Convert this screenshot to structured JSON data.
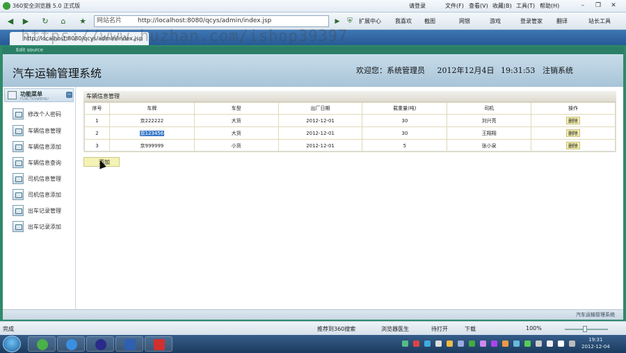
{
  "browser": {
    "title": "360安全浏览器 5.0 正式版",
    "login": "请登录",
    "menu": [
      "文件(F)",
      "查看(V)",
      "收藏(B)",
      "工具(T)",
      "帮助(H)"
    ],
    "address_label": "网站名片",
    "address_url": "http://localhost:8080/qcys/admin/index.jsp",
    "toolbar": [
      "扩展中心",
      "我喜欢",
      "截图",
      "网银",
      "游戏",
      "登录管家",
      "翻译",
      "站长工具"
    ],
    "tab_title": "http://localhost:8080/qcys/admin/index.jsp",
    "status_left": "完成",
    "status_items": [
      "推荐到360搜索",
      "浏览器医生",
      "待打开",
      "下载",
      "100%"
    ],
    "zoom": "100%"
  },
  "frame": {
    "head": "Edit source"
  },
  "app": {
    "title": "汽车运输管理系统",
    "welcome": "欢迎您：系统管理员",
    "date": "2012年12月4日",
    "time": "19:31:53",
    "logout": "注销系统",
    "footer": "汽车运输管理系统"
  },
  "sidebar": {
    "title": "功能菜单",
    "subtitle": "FUNCTIONMENU",
    "items": [
      {
        "label": "修改个人密码"
      },
      {
        "label": "车辆信息管理"
      },
      {
        "label": "车辆信息添加"
      },
      {
        "label": "车辆信息查询"
      },
      {
        "label": "司机信息管理"
      },
      {
        "label": "司机信息添加"
      },
      {
        "label": "出车记录管理"
      },
      {
        "label": "出车记录添加"
      }
    ]
  },
  "panel": {
    "title": "车辆信息管理",
    "columns": [
      "序号",
      "车牌",
      "车型",
      "出厂日期",
      "载重量(吨)",
      "司机",
      "操作"
    ],
    "rows": [
      {
        "no": "1",
        "plate": "京222222",
        "type": "大货",
        "date": "2012-12-01",
        "load": "30",
        "driver": "刘兴亮",
        "action": "删除"
      },
      {
        "no": "2",
        "plate": "京123456",
        "type": "大货",
        "date": "2012-12-01",
        "load": "30",
        "driver": "王翔翔",
        "action": "删除"
      },
      {
        "no": "3",
        "plate": "京999999",
        "type": "小货",
        "date": "2012-12-01",
        "load": "5",
        "driver": "张小泉",
        "action": "删除"
      }
    ],
    "add_label": "添加"
  },
  "taskbar": {
    "time": "19:31",
    "date": "2012-12-04"
  },
  "watermark": "https://www.huzhan.com/ishop39397",
  "colors": {
    "frame": "#2e8a6a",
    "header": "#b9d2e3",
    "selection": "#3a78c8",
    "button": "#f4f0b0"
  }
}
